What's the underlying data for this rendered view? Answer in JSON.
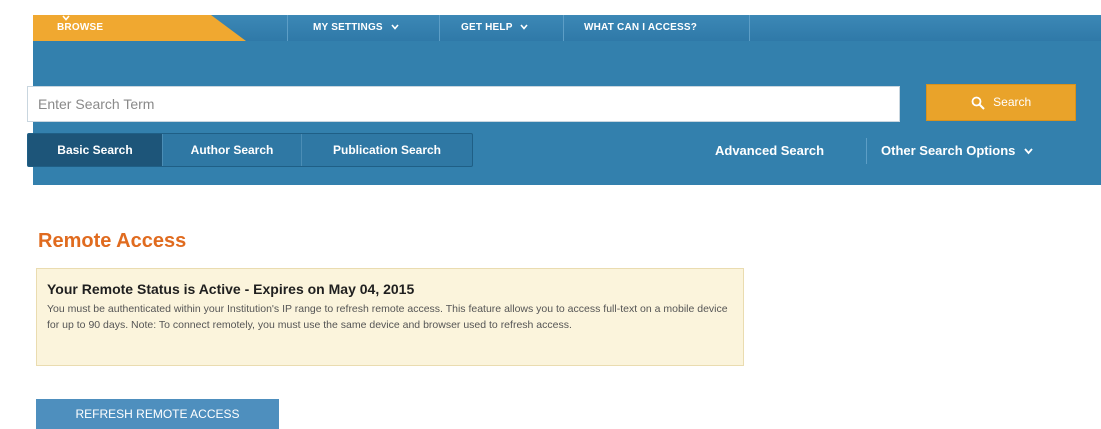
{
  "nav": {
    "browse": "BROWSE",
    "my_settings": "MY SETTINGS",
    "get_help": "GET HELP",
    "what_can_i_access": "WHAT CAN I ACCESS?"
  },
  "search": {
    "placeholder": "Enter Search Term",
    "button_label": "Search",
    "tabs": [
      "Basic Search",
      "Author Search",
      "Publication Search"
    ],
    "advanced_link": "Advanced Search",
    "other_options": "Other Search Options"
  },
  "main": {
    "title": "Remote Access",
    "status_heading": "Your Remote Status is Active - Expires on May 04, 2015",
    "status_body": "You must be authenticated within your Institution's IP range to refresh remote access. This feature allows you to access full-text on a mobile device for up to 90 days. Note: To connect remotely, you must use the same device and browser used to refresh access.",
    "refresh_button": "REFRESH REMOTE ACCESS"
  },
  "colors": {
    "nav_bar": "#3380ad",
    "browse_tab": "#f0a830",
    "search_button": "#e9a32a",
    "title": "#e06b1f",
    "status_bg": "#fbf4dc",
    "refresh_button": "#4e8fbe"
  },
  "icons": {
    "chevron": "chevron-down-icon",
    "search": "search-icon"
  }
}
